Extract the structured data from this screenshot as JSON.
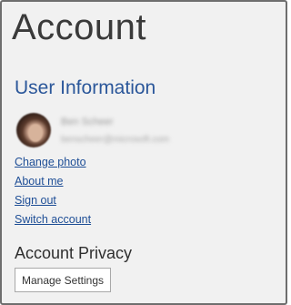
{
  "page": {
    "title": "Account"
  },
  "user_information": {
    "heading": "User Information",
    "user": {
      "name": "Ben Scheer",
      "email": "benscheer@microsoft.com"
    },
    "links": {
      "change_photo": "Change photo",
      "about_me": "About me",
      "sign_out": "Sign out",
      "switch_account": "Switch account"
    }
  },
  "account_privacy": {
    "heading": "Account Privacy",
    "manage_settings_label": "Manage Settings"
  },
  "colors": {
    "background": "#f1f1f1",
    "border": "#6e6e6e",
    "heading_accent": "#2b579a",
    "link": "#1e4e96"
  }
}
